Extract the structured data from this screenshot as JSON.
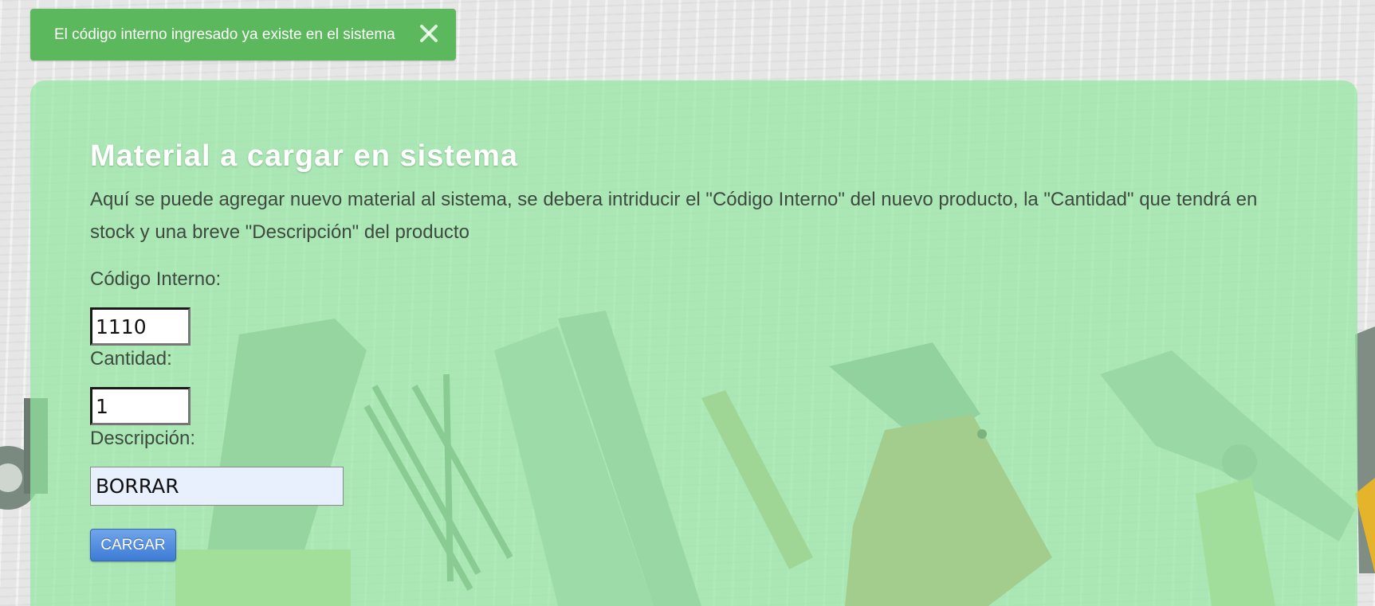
{
  "alert": {
    "message": "El código interno ingresado ya existe en el sistema",
    "close_icon": "close-icon",
    "color": "#5cb85c"
  },
  "panel": {
    "title": "Material a cargar en sistema",
    "description": "Aquí se puede agregar nuevo material al sistema, se debera intriducir el \"Código Interno\" del nuevo producto, la \"Cantidad\" que tendrá en stock y una breve \"Descripción\" del producto",
    "background_color": "#94e8a2"
  },
  "form": {
    "codigo_label": "Código Interno:",
    "codigo_value": "1110",
    "cantidad_label": "Cantidad:",
    "cantidad_value": "1",
    "descripcion_label": "Descripción:",
    "descripcion_value": "BORRAR",
    "submit_label": "CARGAR",
    "submit_color": "#4a86d8"
  },
  "background": {
    "image_icon": "tools-background-image"
  }
}
